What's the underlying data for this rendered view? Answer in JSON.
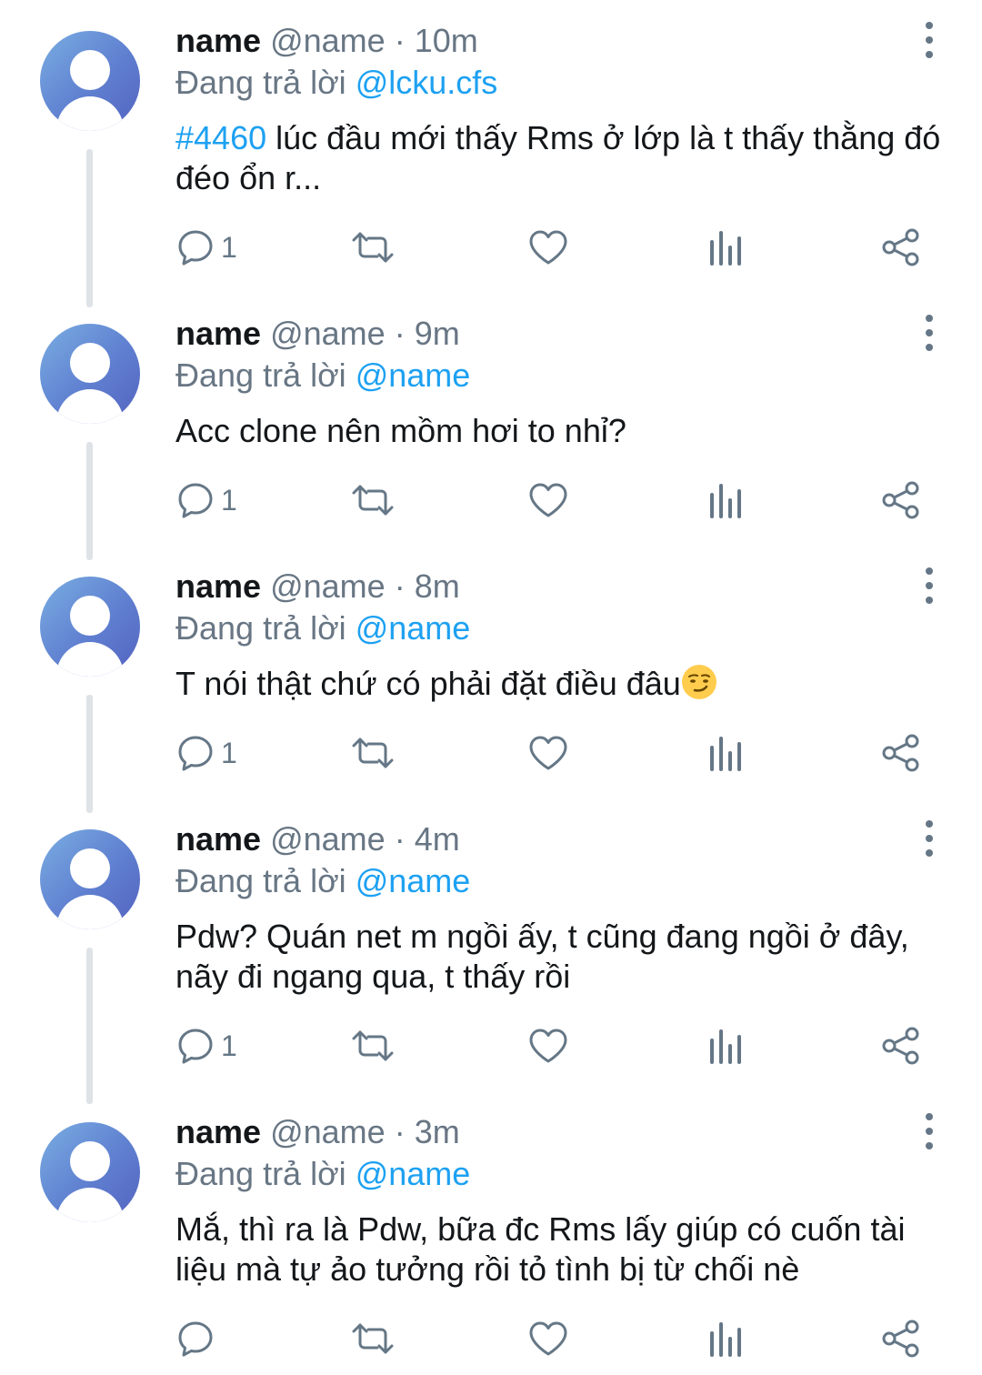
{
  "colors": {
    "accent": "#1da1f2",
    "muted": "#687684",
    "text": "#14171a",
    "thread_line": "#dfe3e7"
  },
  "tweets": [
    {
      "name": "name",
      "handle": "@name",
      "sep": "·",
      "time": "10m",
      "reply_prefix": "Đang trả lời",
      "reply_to": "@lcku.cfs",
      "hashtag": "#4460",
      "text": "lúc đầu mới thấy Rms ở lớp là t thấy thằng đó đéo ổn r...",
      "reply_count": "1"
    },
    {
      "name": "name",
      "handle": "@name",
      "sep": "·",
      "time": "9m",
      "reply_prefix": "Đang trả lời",
      "reply_to": "@name",
      "text": "Acc clone nên mồm hơi to nhỉ?",
      "reply_count": "1"
    },
    {
      "name": "name",
      "handle": "@name",
      "sep": "·",
      "time": "8m",
      "reply_prefix": "Đang trả lời",
      "reply_to": "@name",
      "text": "T nói thật chứ có phải đặt điều đâu",
      "emoji": "smirking-face-emoji",
      "reply_count": "1"
    },
    {
      "name": "name",
      "handle": "@name",
      "sep": "·",
      "time": "4m",
      "reply_prefix": "Đang trả lời",
      "reply_to": "@name",
      "text": "Pdw? Quán net m ngồi ấy, t cũng đang ngồi ở đây, nãy đi ngang qua, t thấy rồi",
      "reply_count": "1"
    },
    {
      "name": "name",
      "handle": "@name",
      "sep": "·",
      "time": "3m",
      "reply_prefix": "Đang trả lời",
      "reply_to": "@name",
      "text": "Mắ, thì ra là Pdw, bữa đc Rms lấy giúp có cuốn tài liệu mà tự ảo tưởng rồi tỏ tình bị từ chối nè",
      "reply_count": ""
    }
  ],
  "icons": [
    "reply-icon",
    "retweet-icon",
    "like-icon",
    "analytics-icon",
    "share-icon",
    "more-icon",
    "avatar-icon"
  ]
}
